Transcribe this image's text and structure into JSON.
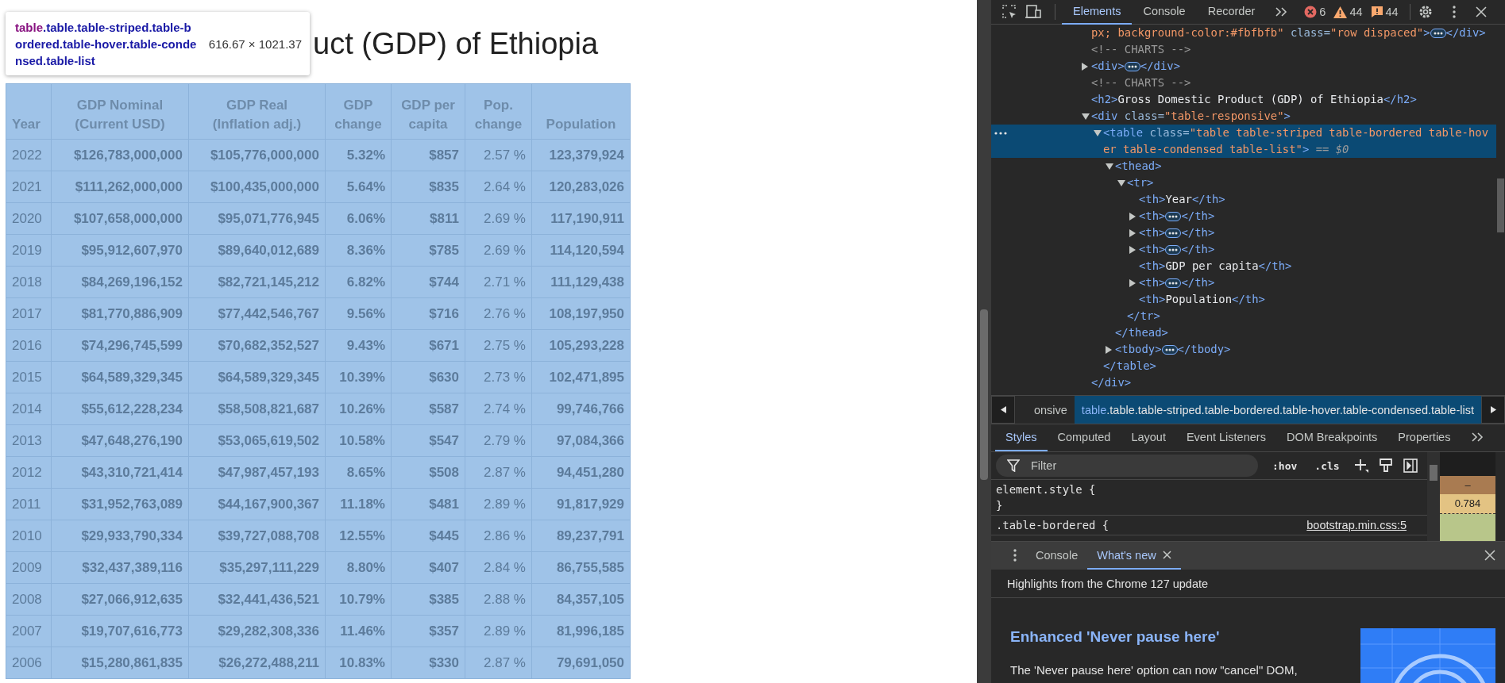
{
  "page": {
    "title": "uct (GDP) of Ethiopia",
    "tooltip": {
      "tag": "table",
      "classes": ".table.table-striped.table-bordered.table-hover.table-condensed.table-list",
      "size": "616.67 × 1021.37"
    },
    "table": {
      "columns": [
        {
          "label": "Year",
          "bold": false,
          "kind": "year"
        },
        {
          "label": "GDP Nominal\n(Current USD)",
          "bold": true,
          "kind": "number"
        },
        {
          "label": "GDP Real\n(Inflation adj.)",
          "bold": true,
          "kind": "number"
        },
        {
          "label": "GDP\nchange",
          "bold": true,
          "kind": "number"
        },
        {
          "label": "GDP per\ncapita",
          "bold": true,
          "kind": "number"
        },
        {
          "label": "Pop.\nchange",
          "bold": false,
          "kind": "number"
        },
        {
          "label": "Population",
          "bold": true,
          "kind": "number"
        }
      ],
      "rows": [
        [
          "2022",
          "$126,783,000,000",
          "$105,776,000,000",
          "5.32%",
          "$857",
          "2.57 %",
          "123,379,924"
        ],
        [
          "2021",
          "$111,262,000,000",
          "$100,435,000,000",
          "5.64%",
          "$835",
          "2.64 %",
          "120,283,026"
        ],
        [
          "2020",
          "$107,658,000,000",
          "$95,071,776,945",
          "6.06%",
          "$811",
          "2.69 %",
          "117,190,911"
        ],
        [
          "2019",
          "$95,912,607,970",
          "$89,640,012,689",
          "8.36%",
          "$785",
          "2.69 %",
          "114,120,594"
        ],
        [
          "2018",
          "$84,269,196,152",
          "$82,721,145,212",
          "6.82%",
          "$744",
          "2.71 %",
          "111,129,438"
        ],
        [
          "2017",
          "$81,770,886,909",
          "$77,442,546,767",
          "9.56%",
          "$716",
          "2.76 %",
          "108,197,950"
        ],
        [
          "2016",
          "$74,296,745,599",
          "$70,682,352,527",
          "9.43%",
          "$671",
          "2.75 %",
          "105,293,228"
        ],
        [
          "2015",
          "$64,589,329,345",
          "$64,589,329,345",
          "10.39%",
          "$630",
          "2.73 %",
          "102,471,895"
        ],
        [
          "2014",
          "$55,612,228,234",
          "$58,508,821,687",
          "10.26%",
          "$587",
          "2.74 %",
          "99,746,766"
        ],
        [
          "2013",
          "$47,648,276,190",
          "$53,065,619,502",
          "10.58%",
          "$547",
          "2.79 %",
          "97,084,366"
        ],
        [
          "2012",
          "$43,310,721,414",
          "$47,987,457,193",
          "8.65%",
          "$508",
          "2.87 %",
          "94,451,280"
        ],
        [
          "2011",
          "$31,952,763,089",
          "$44,167,900,367",
          "11.18%",
          "$481",
          "2.89 %",
          "91,817,929"
        ],
        [
          "2010",
          "$29,933,790,334",
          "$39,727,088,708",
          "12.55%",
          "$445",
          "2.86 %",
          "89,237,791"
        ],
        [
          "2009",
          "$32,437,389,116",
          "$35,297,111,229",
          "8.80%",
          "$407",
          "2.84 %",
          "86,755,585"
        ],
        [
          "2008",
          "$27,066,912,635",
          "$32,441,436,521",
          "10.79%",
          "$385",
          "2.88 %",
          "84,357,105"
        ],
        [
          "2007",
          "$19,707,616,773",
          "$29,282,308,336",
          "11.46%",
          "$357",
          "2.89 %",
          "81,996,185"
        ],
        [
          "2006",
          "$15,280,861,835",
          "$26,272,488,211",
          "10.83%",
          "$330",
          "2.87 %",
          "79,691,050"
        ]
      ]
    }
  },
  "devtools": {
    "tabs": [
      {
        "label": "Elements",
        "selected": true
      },
      {
        "label": "Console",
        "selected": false
      },
      {
        "label": "Recorder",
        "selected": false
      }
    ],
    "counts": [
      {
        "kind": "error",
        "count": "6"
      },
      {
        "kind": "warning",
        "count": "44"
      },
      {
        "kind": "info",
        "count": "44"
      }
    ],
    "elements_tree": [
      {
        "selected": false,
        "segments": [
          {
            "kind": "value",
            "text": "px; background-color:#fbfbfb\""
          },
          {
            "kind": "attr",
            "text": " class="
          },
          {
            "kind": "value",
            "text": "\"row dispaced\""
          },
          {
            "kind": "tag",
            "text": ">"
          },
          {
            "kind": "badge"
          },
          {
            "kind": "tag",
            "text": "</div>"
          }
        ]
      },
      {
        "selected": false,
        "segments": [
          {
            "kind": "comment",
            "text": "<!-- CHARTS -->"
          }
        ]
      },
      {
        "selected": false,
        "expanded": false,
        "segments": [
          {
            "kind": "tag",
            "text": "<div>"
          },
          {
            "kind": "badge"
          },
          {
            "kind": "tag",
            "text": "</div>"
          }
        ]
      },
      {
        "selected": false,
        "segments": [
          {
            "kind": "comment",
            "text": "<!-- CHARTS -->"
          }
        ]
      },
      {
        "selected": false,
        "segments": [
          {
            "kind": "tag",
            "text": "<h2>"
          },
          {
            "kind": "text",
            "text": "Gross Domestic Product (GDP) of Ethiopia"
          },
          {
            "kind": "tag",
            "text": "</h2>"
          }
        ]
      },
      {
        "selected": false,
        "expanded": true,
        "segments": [
          {
            "kind": "tag",
            "text": "<div"
          },
          {
            "kind": "attr",
            "text": " class="
          },
          {
            "kind": "value",
            "text": "\"table-responsive\""
          },
          {
            "kind": "tag",
            "text": ">"
          }
        ],
        "closing": [
          {
            "kind": "tag",
            "text": "</div>"
          }
        ],
        "children": [
          {
            "selected": true,
            "expanded": true,
            "segments": [
              {
                "kind": "tag",
                "text": "<table"
              },
              {
                "kind": "attr",
                "text": " class="
              },
              {
                "kind": "value",
                "text": "\"table table-striped table-bordered table-hover table-condensed table-list\""
              },
              {
                "kind": "tag",
                "text": ">"
              },
              {
                "kind": "marker",
                "text": " == $0"
              }
            ],
            "closing": [
              {
                "kind": "tag",
                "text": "</table>"
              }
            ],
            "children": [
              {
                "selected": false,
                "expanded": true,
                "segments": [
                  {
                    "kind": "tag",
                    "text": "<thead>"
                  }
                ],
                "closing": [
                  {
                    "kind": "tag",
                    "text": "</thead>"
                  }
                ],
                "children": [
                  {
                    "selected": false,
                    "expanded": true,
                    "segments": [
                      {
                        "kind": "tag",
                        "text": "<tr>"
                      }
                    ],
                    "closing": [
                      {
                        "kind": "tag",
                        "text": "</tr>"
                      }
                    ],
                    "children": [
                      {
                        "selected": false,
                        "segments": [
                          {
                            "kind": "tag",
                            "text": "<th>"
                          },
                          {
                            "kind": "text",
                            "text": "Year"
                          },
                          {
                            "kind": "tag",
                            "text": "</th>"
                          }
                        ]
                      },
                      {
                        "selected": false,
                        "expanded": false,
                        "segments": [
                          {
                            "kind": "tag",
                            "text": "<th>"
                          },
                          {
                            "kind": "badge"
                          },
                          {
                            "kind": "tag",
                            "text": "</th>"
                          }
                        ]
                      },
                      {
                        "selected": false,
                        "expanded": false,
                        "segments": [
                          {
                            "kind": "tag",
                            "text": "<th>"
                          },
                          {
                            "kind": "badge"
                          },
                          {
                            "kind": "tag",
                            "text": "</th>"
                          }
                        ]
                      },
                      {
                        "selected": false,
                        "expanded": false,
                        "segments": [
                          {
                            "kind": "tag",
                            "text": "<th>"
                          },
                          {
                            "kind": "badge"
                          },
                          {
                            "kind": "tag",
                            "text": "</th>"
                          }
                        ]
                      },
                      {
                        "selected": false,
                        "segments": [
                          {
                            "kind": "tag",
                            "text": "<th>"
                          },
                          {
                            "kind": "text",
                            "text": "GDP per capita"
                          },
                          {
                            "kind": "tag",
                            "text": "</th>"
                          }
                        ]
                      },
                      {
                        "selected": false,
                        "expanded": false,
                        "segments": [
                          {
                            "kind": "tag",
                            "text": "<th>"
                          },
                          {
                            "kind": "badge"
                          },
                          {
                            "kind": "tag",
                            "text": "</th>"
                          }
                        ]
                      },
                      {
                        "selected": false,
                        "segments": [
                          {
                            "kind": "tag",
                            "text": "<th>"
                          },
                          {
                            "kind": "text",
                            "text": "Population"
                          },
                          {
                            "kind": "tag",
                            "text": "</th>"
                          }
                        ]
                      }
                    ]
                  }
                ]
              },
              {
                "selected": false,
                "expanded": false,
                "segments": [
                  {
                    "kind": "tag",
                    "text": "<tbody>"
                  },
                  {
                    "kind": "badge"
                  },
                  {
                    "kind": "tag",
                    "text": "</tbody>"
                  }
                ]
              }
            ]
          }
        ]
      }
    ],
    "breadcrumbs": [
      {
        "text": "onsive",
        "selected": false
      },
      {
        "tag": "table",
        "classes": ".table.table-striped.table-bordered.table-hover.table-condensed.table-list",
        "selected": true
      }
    ],
    "panel_tabs": [
      {
        "label": "Styles",
        "selected": true
      },
      {
        "label": "Computed",
        "selected": false
      },
      {
        "label": "Layout",
        "selected": false
      },
      {
        "label": "Event Listeners",
        "selected": false
      },
      {
        "label": "DOM Breakpoints",
        "selected": false
      },
      {
        "label": "Properties",
        "selected": false
      }
    ],
    "filter": {
      "placeholder": "Filter"
    },
    "style_buttons": [
      ":hov",
      ".cls"
    ],
    "rules": [
      {
        "selector": "element.style {",
        "closing": "}"
      },
      {
        "selector": ".table-bordered {",
        "source": "bootstrap.min.css:5"
      }
    ],
    "box_model": {
      "margin": "–",
      "border": "0.784"
    },
    "drawer": {
      "tabs": [
        {
          "label": "Console",
          "selected": false,
          "closable": false
        },
        {
          "label": "What's new",
          "selected": true,
          "closable": true
        }
      ],
      "header": "Highlights from the Chrome 127 update",
      "article_title": "Enhanced 'Never pause here'",
      "article_text": "The 'Never pause here' option can now \"cancel\" DOM,"
    }
  }
}
